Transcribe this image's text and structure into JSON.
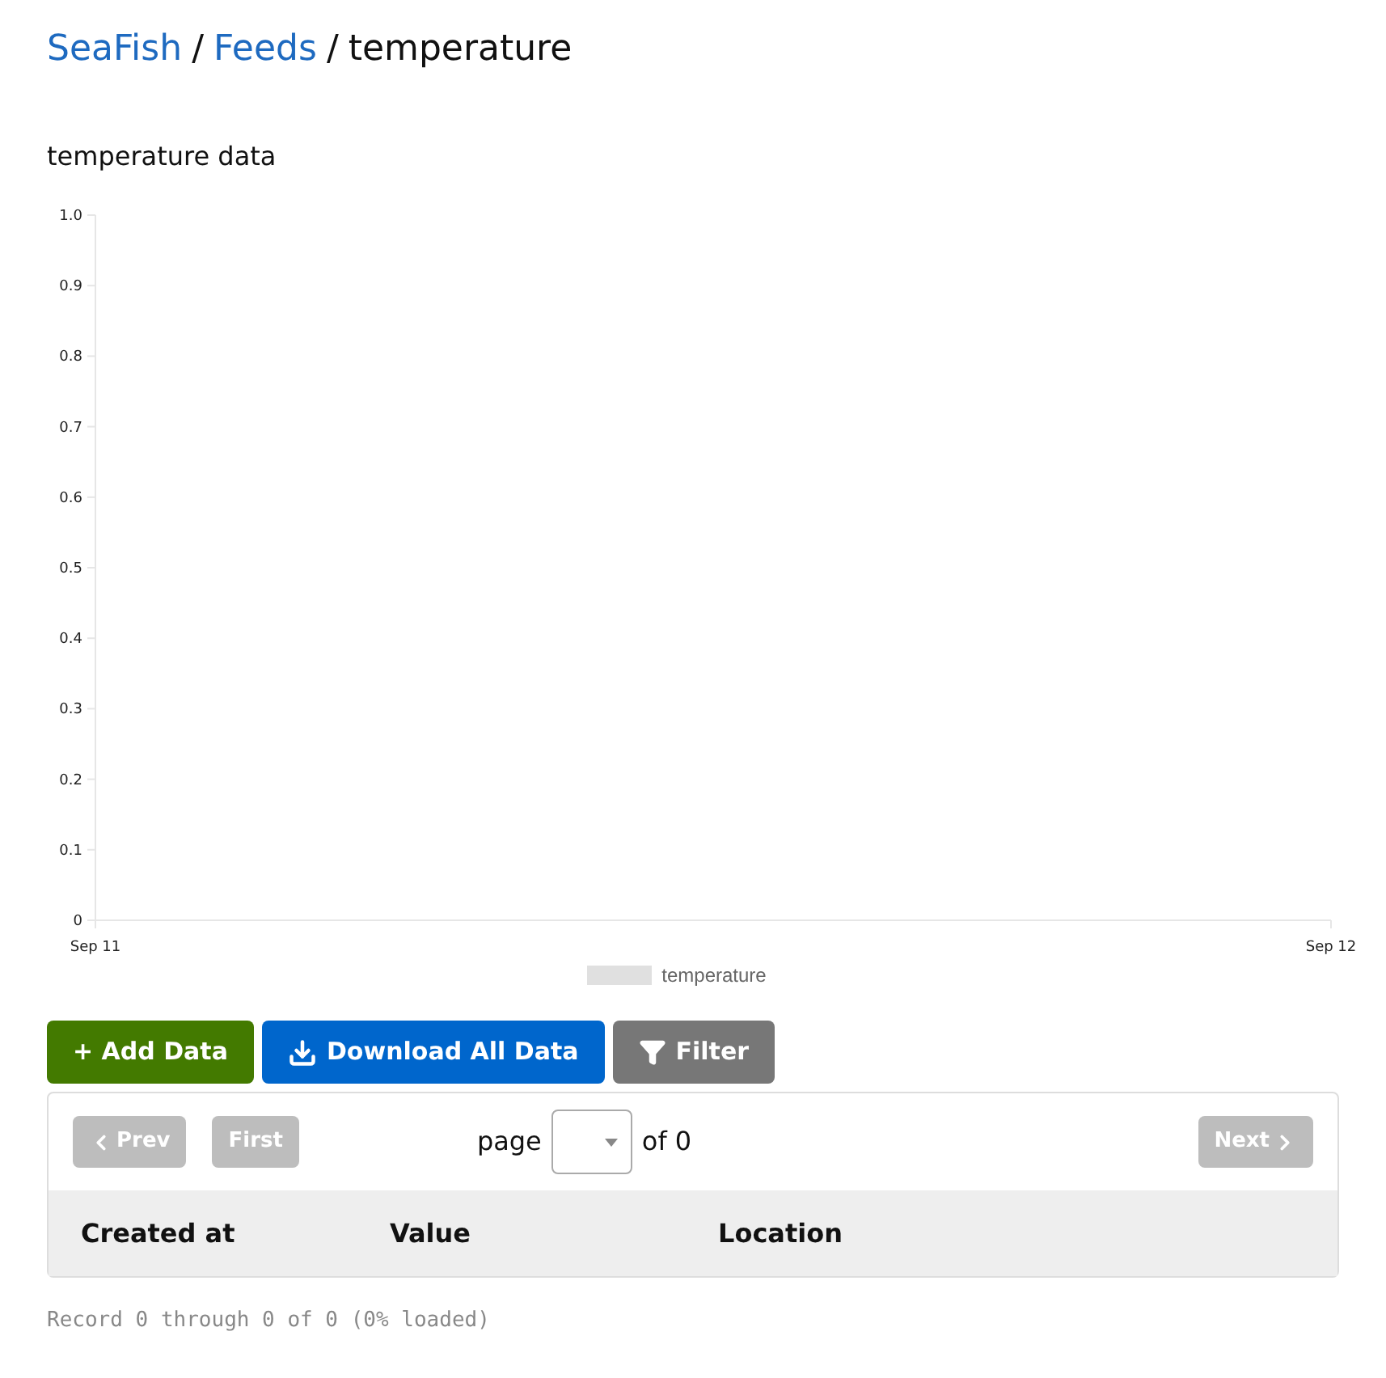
{
  "breadcrumb": [
    {
      "text": "SeaFish",
      "kind": "link"
    },
    {
      "text": "/",
      "kind": "separator"
    },
    {
      "text": "Feeds",
      "kind": "link"
    },
    {
      "text": "/",
      "kind": "separator"
    },
    {
      "text": "temperature",
      "kind": "current"
    }
  ],
  "chart": {
    "title": "temperature data",
    "chart_data": {
      "type": "line",
      "categories": [
        "Sep 11",
        "Sep 12"
      ],
      "series": [
        {
          "name": "temperature",
          "color": "#e0e0e0",
          "values": [
            null,
            null
          ]
        }
      ],
      "ylim": [
        0,
        1
      ],
      "yticks": [
        {
          "value": 0,
          "label": "0"
        },
        {
          "value": 0.1,
          "label": "0.1"
        },
        {
          "value": 0.2,
          "label": "0.2"
        },
        {
          "value": 0.3,
          "label": "0.3"
        },
        {
          "value": 0.4,
          "label": "0.4"
        },
        {
          "value": 0.5,
          "label": "0.5"
        },
        {
          "value": 0.6,
          "label": "0.6"
        },
        {
          "value": 0.7,
          "label": "0.7"
        },
        {
          "value": 0.8,
          "label": "0.8"
        },
        {
          "value": 0.9,
          "label": "0.9"
        },
        {
          "value": 1,
          "label": "1.0"
        }
      ]
    }
  },
  "actions": [
    {
      "label": "+ Add Data",
      "kind": "add"
    },
    {
      "label": "Download All Data",
      "kind": "download"
    },
    {
      "label": "Filter",
      "kind": "filter"
    }
  ],
  "pager": {
    "prev": {
      "label": "Prev",
      "disabled": true
    },
    "first": {
      "label": "First",
      "disabled": true
    },
    "page_label": "page",
    "of_label": "of 0",
    "next": {
      "label": "Next",
      "disabled": true
    }
  },
  "table": {
    "columns": [
      "Created at",
      "Value",
      "Location"
    ]
  },
  "status": "Record 0 through 0 of 0 (0% loaded)"
}
